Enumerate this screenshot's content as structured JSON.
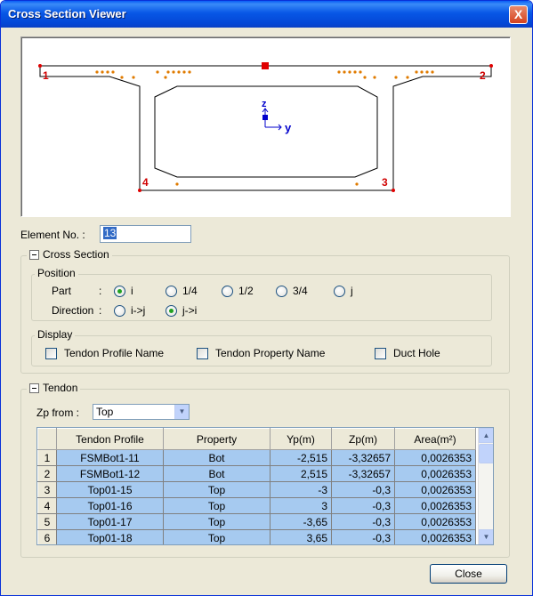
{
  "window": {
    "title": "Cross Section Viewer",
    "close_glyph": "X"
  },
  "viewer": {
    "corner_labels": [
      "1",
      "2",
      "3",
      "4"
    ],
    "axis_z": "z",
    "axis_y": "y",
    "colors": {
      "outline": "#000000",
      "tendon": "#e07b00",
      "node": "#e00000",
      "axis": "#0000cc",
      "label": "#d00000"
    }
  },
  "element": {
    "label": "Element No. :",
    "value": "13"
  },
  "cross_section": {
    "title": "Cross Section",
    "position": {
      "title": "Position",
      "part_label": "Part",
      "colon": ":",
      "part_options": [
        "i",
        "1/4",
        "1/2",
        "3/4",
        "j"
      ],
      "part_selected": "i",
      "direction_label": "Direction",
      "direction_options": [
        "i->j",
        "j->i"
      ],
      "direction_selected": "j->i"
    },
    "display": {
      "title": "Display",
      "options": [
        "Tendon Profile Name",
        "Tendon Property Name",
        "Duct Hole"
      ]
    }
  },
  "tendon": {
    "title": "Tendon",
    "zp_label": "Zp from :",
    "zp_value": "Top",
    "columns": [
      "Tendon Profile",
      "Property",
      "Yp(m)",
      "Zp(m)",
      "Area(m²)"
    ],
    "rows": [
      {
        "n": "1",
        "profile": "FSMBot1-11",
        "property": "Bot",
        "yp": "-2,515",
        "zp": "-3,32657",
        "area": "0,0026353"
      },
      {
        "n": "2",
        "profile": "FSMBot1-12",
        "property": "Bot",
        "yp": "2,515",
        "zp": "-3,32657",
        "area": "0,0026353"
      },
      {
        "n": "3",
        "profile": "Top01-15",
        "property": "Top",
        "yp": "-3",
        "zp": "-0,3",
        "area": "0,0026353"
      },
      {
        "n": "4",
        "profile": "Top01-16",
        "property": "Top",
        "yp": "3",
        "zp": "-0,3",
        "area": "0,0026353"
      },
      {
        "n": "5",
        "profile": "Top01-17",
        "property": "Top",
        "yp": "-3,65",
        "zp": "-0,3",
        "area": "0,0026353"
      },
      {
        "n": "6",
        "profile": "Top01-18",
        "property": "Top",
        "yp": "3,65",
        "zp": "-0,3",
        "area": "0,0026353"
      }
    ]
  },
  "footer": {
    "close_label": "Close"
  }
}
